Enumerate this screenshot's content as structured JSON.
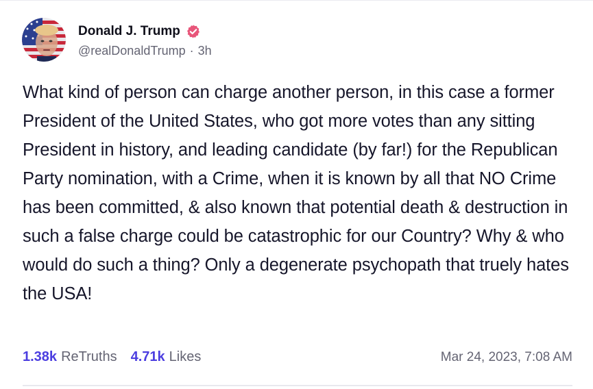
{
  "author": {
    "name": "Donald J. Trump",
    "handle": "@realDonaldTrump",
    "separator": "·",
    "time_ago": "3h",
    "verified_badge_icon": "verified-badge-icon"
  },
  "post": {
    "text": "What kind of person can charge another person, in this case a former President of the United States, who got more votes than any sitting President in history, and leading candidate (by far!) for the Republican Party nomination, with a Crime, when it is known by all that NO Crime has been committed, & also known that potential death & destruction in such a false charge could be catastrophic for our Country? Why & who would do such a thing? Only a degenerate psychopath that truely hates the USA!"
  },
  "stats": {
    "retruths_count": "1.38k",
    "retruths_label": "ReTruths",
    "likes_count": "4.71k",
    "likes_label": "Likes"
  },
  "timestamp": "Mar 24, 2023, 7:08 AM",
  "colors": {
    "accent": "#4b3de0",
    "verified": "#e8567a",
    "muted": "#646473"
  }
}
